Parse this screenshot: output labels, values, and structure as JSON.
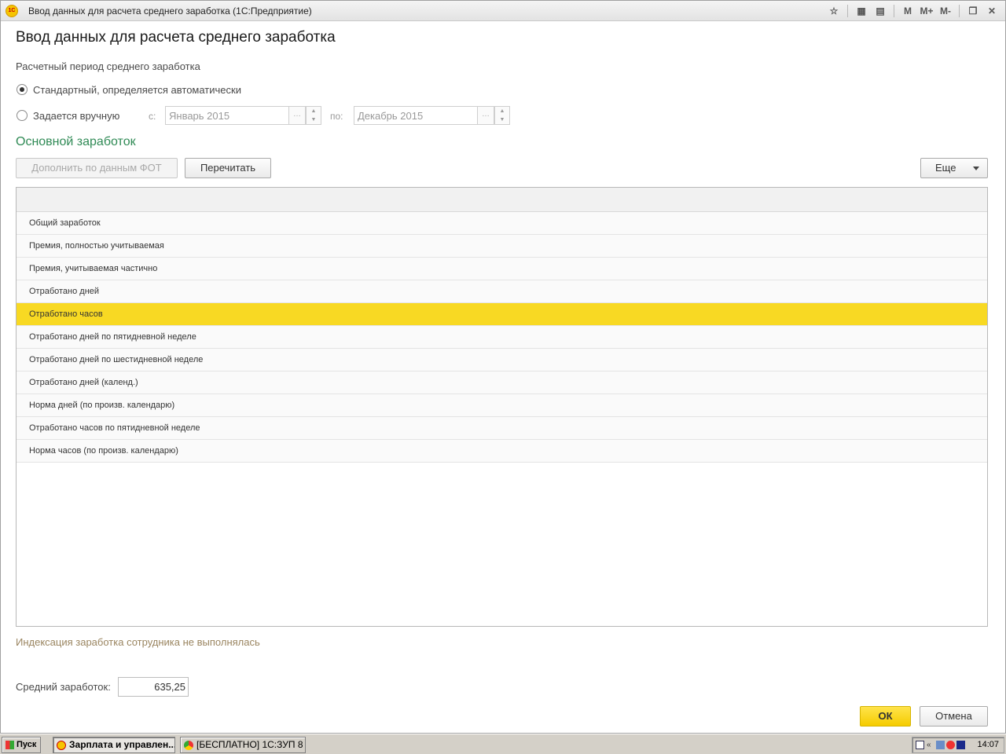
{
  "window": {
    "title": "Ввод данных для расчета среднего заработка  (1С:Предприятие)",
    "toolbar_buttons": [
      "M",
      "M+",
      "M-"
    ]
  },
  "page_title": "Ввод данных для расчета среднего заработка",
  "period": {
    "label": "Расчетный период среднего заработка",
    "option_standard": "Стандартный, определяется автоматически",
    "option_manual": "Задается вручную",
    "from_label": "с:",
    "from_value": "Январь 2015",
    "to_label": "по:",
    "to_value": "Декабрь 2015",
    "selected": "standard"
  },
  "section_title": "Основной заработок",
  "buttons": {
    "fill_fot": "Дополнить по данным ФОТ",
    "recalc": "Перечитать",
    "more": "Еще",
    "ok": "ОК",
    "cancel": "Отмена"
  },
  "table": {
    "rows": [
      "Общий заработок",
      "Премия, полностью учитываемая",
      "Премия, учитываемая частично",
      "Отработано дней",
      "Отработано часов",
      "Отработано дней по пятидневной неделе",
      "Отработано дней по шестидневной неделе",
      "Отработано дней (календ.)",
      "Норма дней (по произв. календарю)",
      "Отработано часов по пятидневной неделе",
      "Норма часов (по произв. календарю)"
    ],
    "selected_row": "Отработано часов"
  },
  "indexation_text": "Индексация заработка сотрудника не выполнялась",
  "average": {
    "label": "Средний заработок:",
    "value": "635,25"
  },
  "taskbar": {
    "start": "Пуск",
    "task1": "Зарплата и управлен...",
    "task2": "[БЕСПЛАТНО] 1С:ЗУП 8 ...",
    "clock": "14:07"
  },
  "colors": {
    "selected_row": "#f8d923",
    "section_title": "#2f8a55",
    "ok_button": "#f5cc00"
  }
}
